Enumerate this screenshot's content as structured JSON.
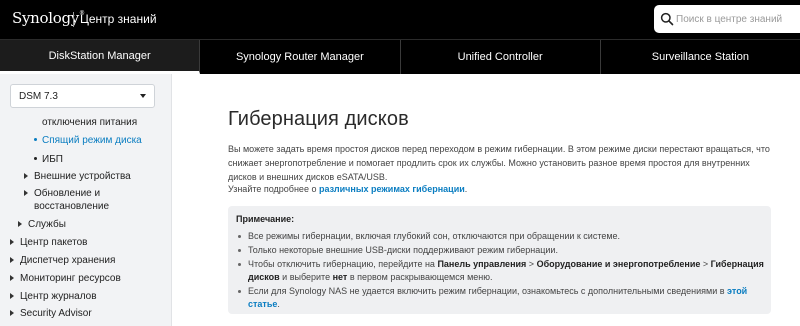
{
  "header": {
    "logo": "Synology",
    "logo_mark": "®",
    "title": "Центр знаний",
    "search_placeholder": "Поиск в центре знаний"
  },
  "products": [
    {
      "label": "DiskStation Manager"
    },
    {
      "label": "Synology Router Manager"
    },
    {
      "label": "Unified Controller"
    },
    {
      "label": "Surveillance Station"
    }
  ],
  "sidebar": {
    "version": "DSM 7.3",
    "items": [
      {
        "label": "отключения питания"
      },
      {
        "label": "Спящий режим диска"
      },
      {
        "label": "ИБП"
      },
      {
        "label": "Внешние устройства"
      },
      {
        "label": "Обновление и"
      },
      {
        "label": "восстановление"
      },
      {
        "label": "Службы"
      },
      {
        "label": "Центр пакетов"
      },
      {
        "label": "Диспетчер хранения"
      },
      {
        "label": "Мониторинг ресурсов"
      },
      {
        "label": "Центр журналов"
      },
      {
        "label": "Security Advisor"
      }
    ]
  },
  "article": {
    "title": "Гибернация дисков",
    "intro": "Вы можете задать время простоя дисков перед переходом в режим гибернации. В этом режиме диски перестают вращаться, что снижает энергопотребление и помогает продлить срок их службы. Можно установить разное время простоя для внутренних дисков и внешних дисков eSATA/USB.",
    "learn_prefix": "Узнайте подробнее о ",
    "learn_link": "различных режимах гибернации",
    "learn_suffix": ".",
    "note": {
      "title": "Примечание:",
      "item1": "Все режимы гибернации, включая глубокий сон, отключаются при обращении к системе.",
      "item2": "Только некоторые внешние USB-диски поддерживают режим гибернации.",
      "item3_a": "Чтобы отключить гибернацию, перейдите на ",
      "item3_b": "Панель управления",
      "item3_c": " > ",
      "item3_d": "Оборудование и энергопотребление",
      "item3_e": " > ",
      "item3_f": "Гибернация дисков",
      "item3_g": " и выберите ",
      "item3_h": "нет",
      "item3_i": " в первом раскрывающемся меню.",
      "item4_a": "Если для Synology NAS не удается включить режим гибернации, ознакомьтесь с дополнительными сведениями в ",
      "item4_link": "этой статье",
      "item4_c": "."
    }
  }
}
